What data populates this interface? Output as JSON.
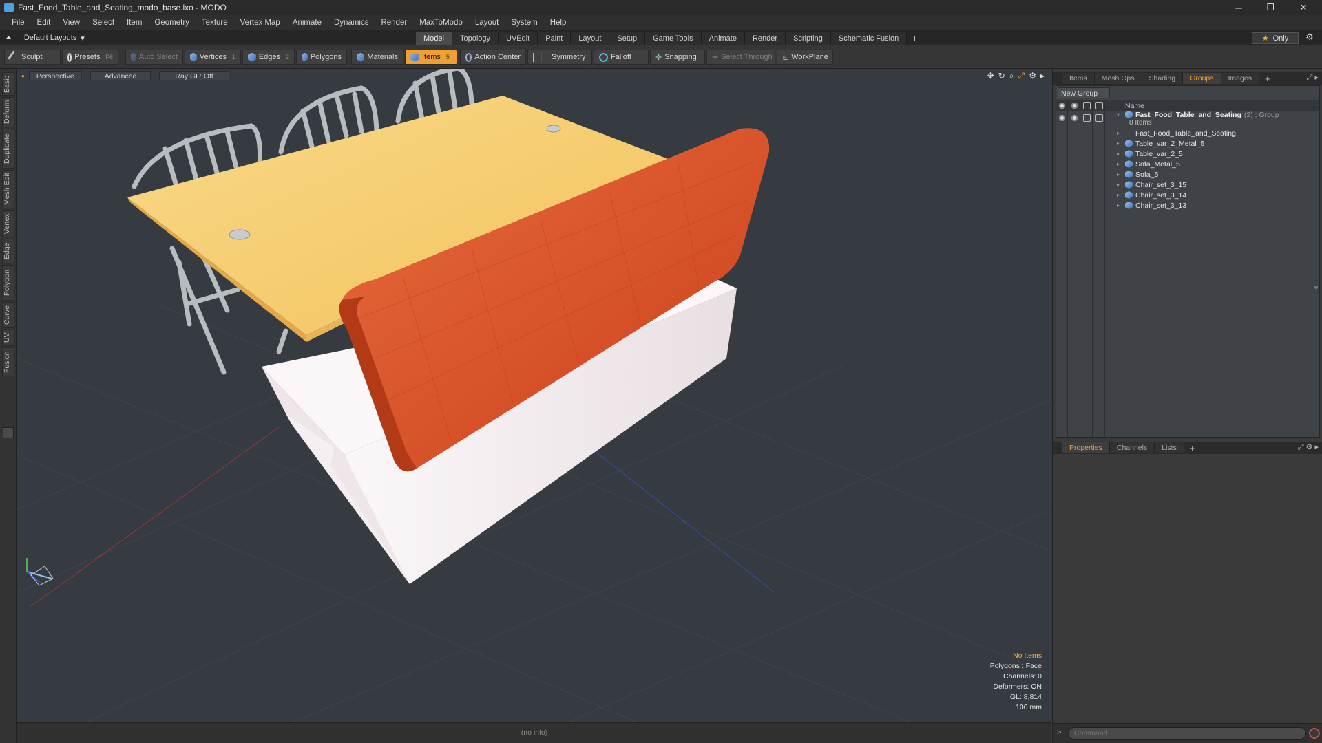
{
  "window": {
    "title": "Fast_Food_Table_and_Seating_modo_base.lxo - MODO",
    "minimize": "─",
    "restore": "❐",
    "close": "✕"
  },
  "menu": [
    "File",
    "Edit",
    "View",
    "Select",
    "Item",
    "Geometry",
    "Texture",
    "Vertex Map",
    "Animate",
    "Dynamics",
    "Render",
    "MaxToModo",
    "Layout",
    "System",
    "Help"
  ],
  "layout": {
    "selector": "Default Layouts",
    "tabs": [
      "Model",
      "Topology",
      "UVEdit",
      "Paint",
      "Layout",
      "Setup",
      "Game Tools",
      "Animate",
      "Render",
      "Scripting",
      "Schematic Fusion"
    ],
    "active_tab": "Model",
    "add": "+",
    "only": "Only"
  },
  "toolbar": {
    "sculpt": "Sculpt",
    "presets": "Presets",
    "presets_key": "F6",
    "auto_select": "Auto Select",
    "vertices": "Vertices",
    "vertices_count": "1",
    "edges": "Edges",
    "edges_count": "2",
    "polygons": "Polygons",
    "materials": "Materials",
    "items": "Items",
    "items_count": "5",
    "action_center": "Action Center",
    "symmetry": "Symmetry",
    "falloff": "Falloff",
    "snapping": "Snapping",
    "select_through": "Select Through",
    "workplane": "WorkPlane"
  },
  "left_tabs": [
    "Basic",
    "Deform",
    "Duplicate",
    "Mesh Edit",
    "Vertex",
    "Edge",
    "Polygon",
    "Curve",
    "UV",
    "Fusion"
  ],
  "viewport": {
    "view": "Perspective",
    "mode": "Advanced",
    "raygl": "Ray GL: Off",
    "hud": {
      "selection": "No Items",
      "polygons": "Polygons : Face",
      "channels": "Channels: 0",
      "deformers": "Deformers: ON",
      "gl": "GL: 8,814",
      "unit": "100 mm"
    }
  },
  "status": {
    "info": "(no info)"
  },
  "right_top_tabs": [
    "Items",
    "Mesh Ops",
    "Shading",
    "Groups",
    "Images"
  ],
  "right_top_active": "Groups",
  "groups": {
    "new_group": "New Group",
    "name_header": "Name",
    "group_name": "Fast_Food_Table_and_Seating",
    "group_meta": "(2) : Group",
    "group_count": "8 Items",
    "items": [
      "Fast_Food_Table_and_Seating",
      "Table_var_2_Metal_5",
      "Table_var_2_5",
      "Sofa_Metal_5",
      "Sofa_5",
      "Chair_set_3_15",
      "Chair_set_3_14",
      "Chair_set_3_13"
    ]
  },
  "right_bottom_tabs": [
    "Properties",
    "Channels",
    "Lists"
  ],
  "right_bottom_active": "Properties",
  "command": {
    "prompt": ">",
    "placeholder": "Command"
  },
  "colors": {
    "accent": "#f0a030",
    "table_top": "#f7cf6e",
    "sofa_back": "#d8522a",
    "sofa_base": "#f4eef0",
    "chair_metal": "#b9bcbf",
    "viewport_bg": "#353b40"
  }
}
